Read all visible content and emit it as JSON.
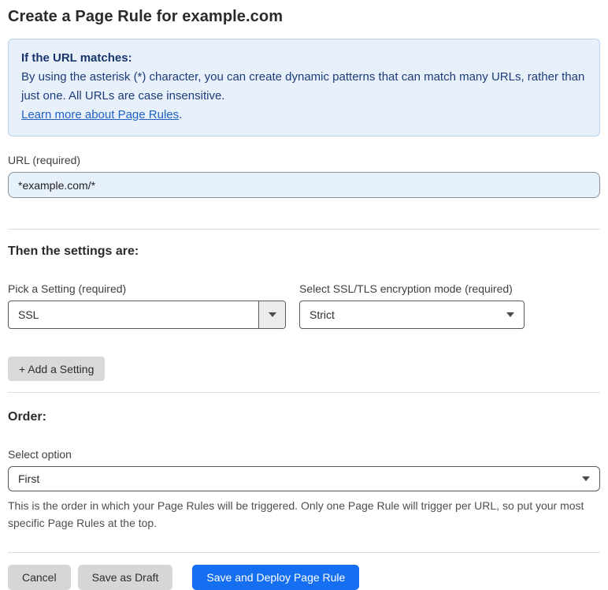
{
  "page": {
    "title": "Create a Page Rule for example.com"
  },
  "info_box": {
    "heading": "If the URL matches:",
    "body": "By using the asterisk (*) character, you can create dynamic patterns that can match many URLs, rather than just one. All URLs are case insensitive.",
    "link_label": "Learn more about Page Rules",
    "link_suffix": "."
  },
  "url_field": {
    "label": "URL (required)",
    "value": "*example.com/*"
  },
  "settings_section": {
    "heading": "Then the settings are:",
    "setting_picker": {
      "label": "Pick a Setting (required)",
      "value": "SSL"
    },
    "ssl_mode_picker": {
      "label": "Select SSL/TLS encryption mode (required)",
      "value": "Strict"
    },
    "add_setting_label": "+ Add a Setting"
  },
  "order_section": {
    "heading": "Order:",
    "select_label": "Select option",
    "selected_value": "First",
    "help_text": "This is the order in which your Page Rules will be triggered. Only one Page Rule will trigger per URL, so put your most specific Page Rules at the top."
  },
  "footer": {
    "cancel_label": "Cancel",
    "save_draft_label": "Save as Draft",
    "save_deploy_label": "Save and Deploy Page Rule"
  },
  "icons": {
    "dropdown_arrow": "chevron-down-icon"
  },
  "colors": {
    "accent_blue": "#166ff0",
    "info_background": "#e8f1fb",
    "info_border": "#b5d3ef",
    "info_text": "#1d3c78",
    "link_blue": "#2161c4",
    "url_input_background": "#e7f0fd",
    "button_gray": "#d6d6d6",
    "divider_gray": "#dcdcdc"
  }
}
